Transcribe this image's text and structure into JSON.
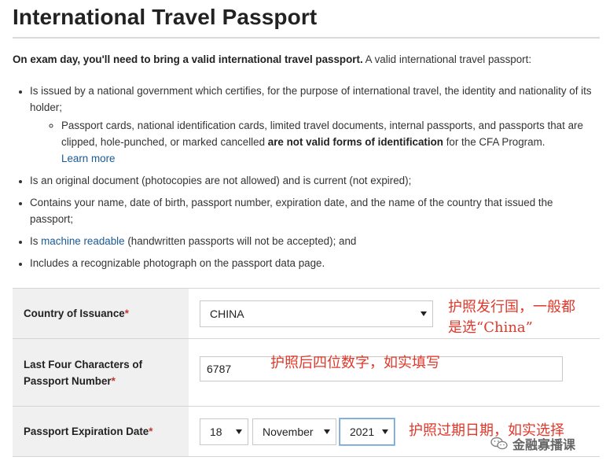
{
  "page": {
    "title": "International Travel Passport"
  },
  "intro": {
    "bold": "On exam day, you'll need to bring a valid international travel passport.",
    "rest": " A valid international travel passport:"
  },
  "requirements": {
    "item1": "Is issued by a national government which certifies, for the purpose of international travel, the identity and nationality of its holder;",
    "sub1_pre": "Passport cards, national identification cards, limited travel documents, internal passports, and passports that are clipped, hole-punched, or marked cancelled ",
    "sub1_bold": "are not valid forms of identification",
    "sub1_post": " for the CFA Program.",
    "sub1_link": "Learn more",
    "item2": "Is an original document (photocopies are not allowed) and is current (not expired);",
    "item3": "Contains your name, date of birth, passport number, expiration date, and the name of the country that issued the passport;",
    "item4_pre": "Is ",
    "item4_link": "machine readable",
    "item4_post": " (handwritten passports will not be accepted); and",
    "item5": "Includes a recognizable photograph on the passport data page."
  },
  "form": {
    "required_mark": "*",
    "country": {
      "label": "Country of Issuance",
      "value": "CHINA"
    },
    "last4": {
      "label_line1": "Last Four Characters of",
      "label_line2": "Passport Number",
      "value": "6787"
    },
    "expiration": {
      "label": "Passport Expiration Date",
      "day": "18",
      "month": "November",
      "year": "2021"
    }
  },
  "annotations": {
    "country_line1": "护照发行国，一般都",
    "country_line2": "是选“China”",
    "last4": "护照后四位数字，如实填写",
    "expiration": "护照过期日期，如实选择",
    "color": "#e0382a"
  },
  "watermark": {
    "text": "金融寡播课",
    "icon": "wechat-icon"
  }
}
